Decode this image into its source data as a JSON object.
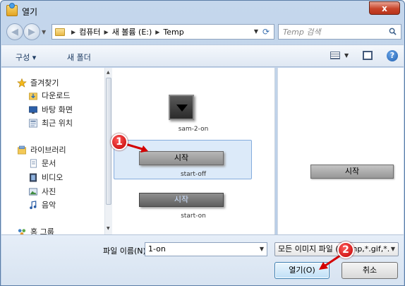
{
  "window": {
    "title": "열기",
    "close_label": "x"
  },
  "address": {
    "crumbs": [
      "컴퓨터",
      "새 볼륨 (E:)",
      "Temp"
    ],
    "search_placeholder": "Temp 검색"
  },
  "toolbar": {
    "organize_label": "구성 ▾",
    "new_folder_label": "새 폴더",
    "help_label": "?"
  },
  "navpane": {
    "items": [
      {
        "label": "즐겨찾기",
        "icon": "star-icon"
      },
      {
        "label": "다운로드",
        "icon": "downloads-folder-icon"
      },
      {
        "label": "바탕 화면",
        "icon": "desktop-icon"
      },
      {
        "label": "최근 위치",
        "icon": "recent-places-icon"
      },
      {
        "label": "라이브러리",
        "icon": "libraries-icon"
      },
      {
        "label": "문서",
        "icon": "documents-icon"
      },
      {
        "label": "비디오",
        "icon": "videos-icon"
      },
      {
        "label": "사진",
        "icon": "pictures-icon"
      },
      {
        "label": "음악",
        "icon": "music-icon"
      },
      {
        "label": "홈 그룹",
        "icon": "homegroup-icon"
      }
    ]
  },
  "files": [
    {
      "name": "sam-2-on"
    },
    {
      "name": "start-off",
      "button_text": "시작"
    },
    {
      "name": "start-on",
      "button_text": "시작"
    }
  ],
  "preview": {
    "button_text": "시작"
  },
  "bottom": {
    "filename_label": "파일 이름(N):",
    "filename_value": "1-on",
    "filter_value": "모든 이미지 파일 (*.bmp,*.gif,*.",
    "open_label": "열기(O)",
    "cancel_label": "취소"
  },
  "annotations": {
    "step1": "1",
    "step2": "2",
    "color": "#d40000"
  }
}
